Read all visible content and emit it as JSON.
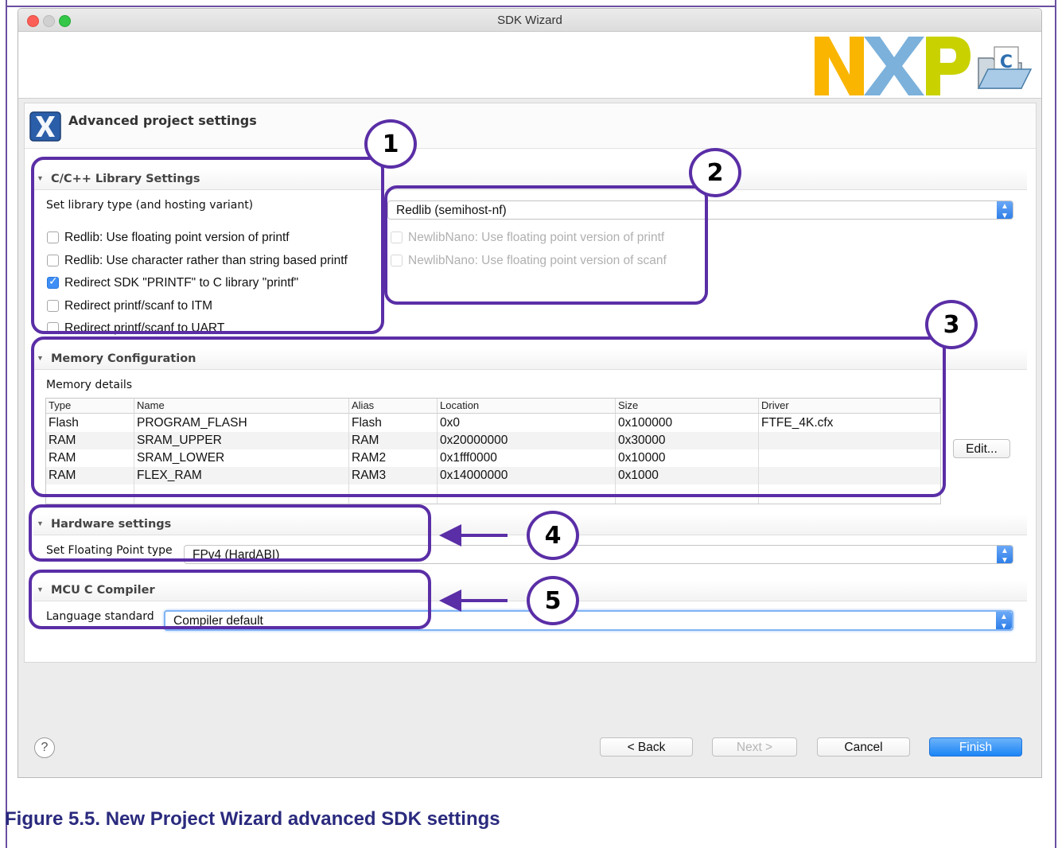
{
  "window": {
    "title": "SDK Wizard"
  },
  "page": {
    "title": "Advanced project settings"
  },
  "library_settings": {
    "title": "C/C++ Library Settings",
    "library_type_label": "Set library type (and hosting variant)",
    "library_type_value": "Redlib (semihost-nf)",
    "options": [
      {
        "label": "Redlib: Use floating point version of printf",
        "checked": false
      },
      {
        "label": "Redlib: Use character rather than string based printf",
        "checked": false
      },
      {
        "label": "Redirect SDK \"PRINTF\" to C library \"printf\"",
        "checked": true
      },
      {
        "label": "Redirect printf/scanf to ITM",
        "checked": false
      },
      {
        "label": "Redirect printf/scanf to UART",
        "checked": false
      }
    ],
    "newlib_options": [
      {
        "label": "NewlibNano: Use floating point version of printf",
        "checked": false,
        "disabled": true
      },
      {
        "label": "NewlibNano: Use floating point version of scanf",
        "checked": false,
        "disabled": true
      }
    ]
  },
  "memory": {
    "title": "Memory Configuration",
    "details_label": "Memory details",
    "columns": [
      "Type",
      "Name",
      "Alias",
      "Location",
      "Size",
      "Driver"
    ],
    "rows": [
      [
        "Flash",
        "PROGRAM_FLASH",
        "Flash",
        "0x0",
        "0x100000",
        "FTFE_4K.cfx"
      ],
      [
        "RAM",
        "SRAM_UPPER",
        "RAM",
        "0x20000000",
        "0x30000",
        ""
      ],
      [
        "RAM",
        "SRAM_LOWER",
        "RAM2",
        "0x1fff0000",
        "0x10000",
        ""
      ],
      [
        "RAM",
        "FLEX_RAM",
        "RAM3",
        "0x14000000",
        "0x1000",
        ""
      ]
    ],
    "edit_button": "Edit..."
  },
  "hardware": {
    "title": "Hardware settings",
    "fp_label": "Set Floating Point type",
    "fp_value": "FPv4 (HardABI)"
  },
  "compiler": {
    "title": "MCU C Compiler",
    "lang_label": "Language standard",
    "lang_value": "Compiler default"
  },
  "footer": {
    "help": "?",
    "back": "< Back",
    "next": "Next >",
    "cancel": "Cancel",
    "finish": "Finish"
  },
  "annotations": [
    "1",
    "2",
    "3",
    "4",
    "5"
  ],
  "caption": "Figure 5.5. New Project Wizard advanced SDK settings",
  "colors": {
    "annotation": "#5a2ea6",
    "caption": "#2a2a7e",
    "accent": "#1c84f5",
    "nxp_yellow": "#f9b500",
    "nxp_blue": "#7bb1db",
    "nxp_green": "#c9d200"
  }
}
